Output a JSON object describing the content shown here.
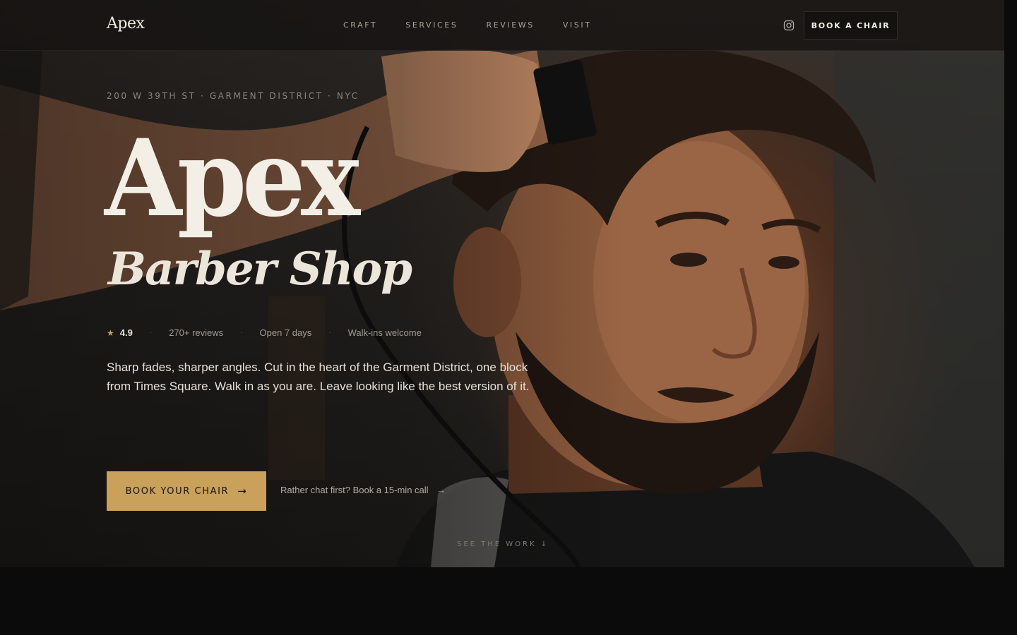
{
  "brand": "Apex",
  "nav": {
    "links": [
      "CRAFT",
      "SERVICES",
      "REVIEWS",
      "VISIT"
    ],
    "book_label": "BOOK A CHAIR",
    "instagram_icon": "instagram-icon"
  },
  "hero": {
    "address": "200 W 39TH ST · GARMENT DISTRICT · NYC",
    "title_line1": "Apex",
    "title_line2": "Barber Shop",
    "meta": {
      "star": "★",
      "rating": "4.9",
      "reviews": "270+ reviews",
      "hours": "Open 7 days",
      "walkins": "Walk-ins welcome",
      "separator": "·"
    },
    "description": "Sharp fades, sharper angles. Cut in the heart of the Garment District, one block from Times Square. Walk in as you are. Leave looking like the best version of it.",
    "cta_label": "BOOK YOUR CHAIR",
    "cta_arrow": "→",
    "chat_label": "Rather chat first? Book a 15-min call",
    "chat_arrow": "→",
    "scroll_label": "SEE THE WORK ↓"
  },
  "colors": {
    "accent": "#c9a15a",
    "background": "#0b0b0b",
    "text": "#ede6dc"
  }
}
